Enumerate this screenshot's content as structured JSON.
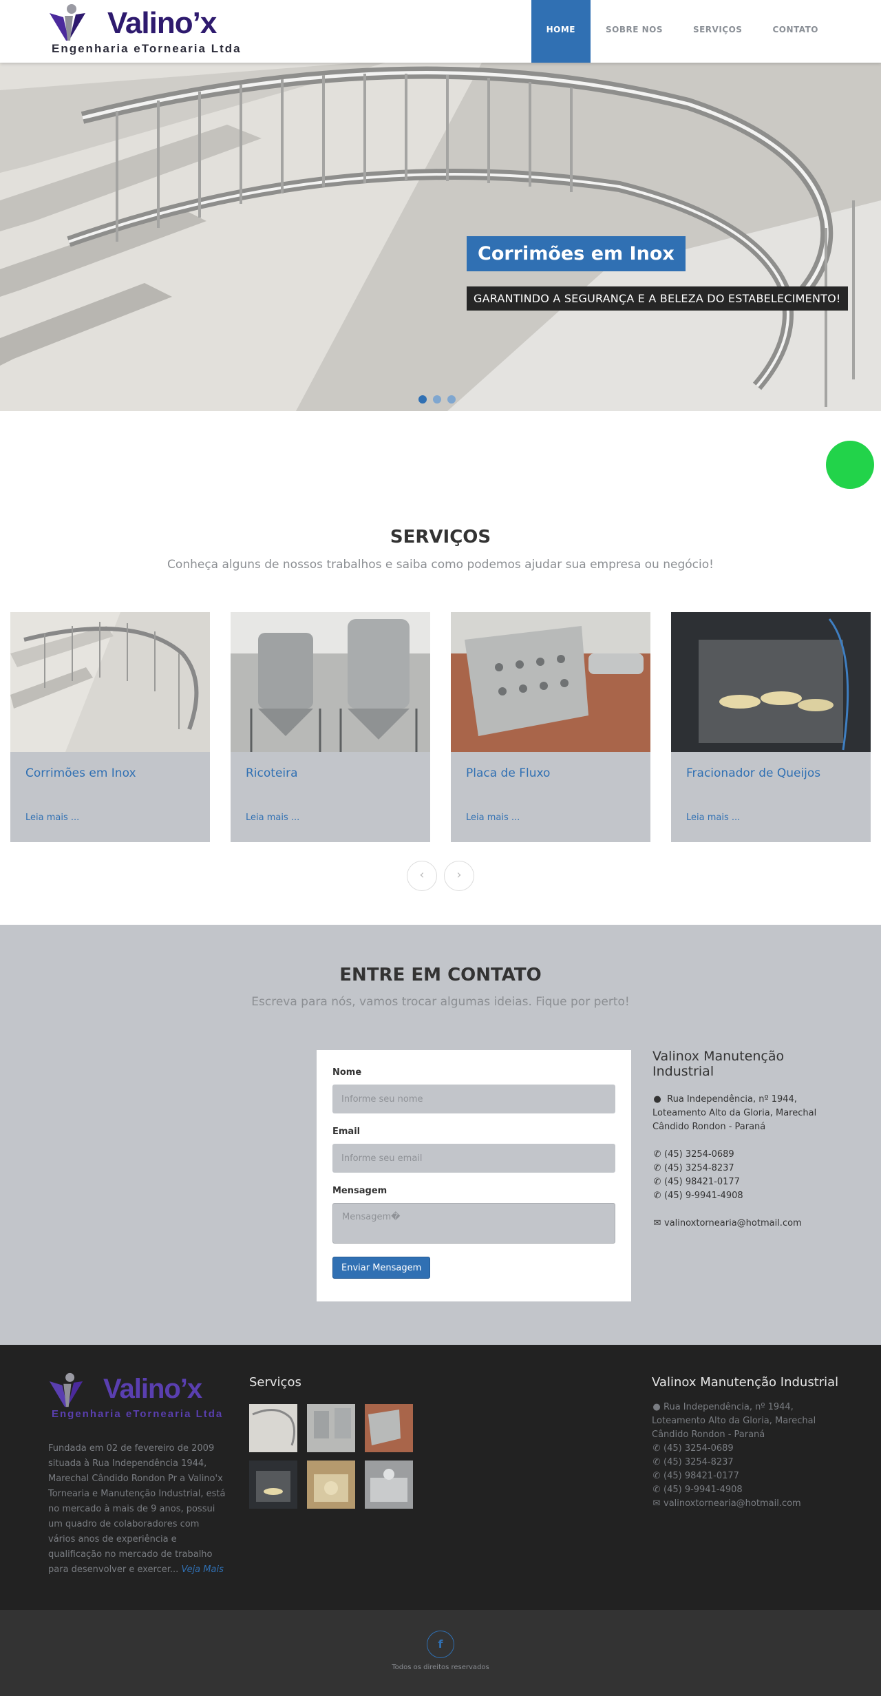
{
  "header": {
    "logo_title": "Valino’x",
    "logo_sub": "Engenharia eTornearia Ltda",
    "nav": [
      {
        "label": "HOME"
      },
      {
        "label": "SOBRE NOS"
      },
      {
        "label": "SERVIÇOS"
      },
      {
        "label": "CONTATO"
      }
    ]
  },
  "hero": {
    "title": "Corrimões em Inox",
    "subtitle": "GARANTINDO A SEGURANÇA E A BELEZA DO ESTABELECIMENTO!",
    "active_slide": 1,
    "slides": 3
  },
  "services": {
    "title": "SERVIÇOS",
    "subtitle": "Conheça alguns de nossos trabalhos e saiba como podemos ajudar sua empresa ou negócio!",
    "cards": [
      {
        "title": "Corrimões em Inox",
        "more": "Leia mais ..."
      },
      {
        "title": "Ricoteira",
        "more": "Leia mais ..."
      },
      {
        "title": "Placa de Fluxo",
        "more": "Leia mais ..."
      },
      {
        "title": "Fracionador de Queijos",
        "more": "Leia mais ..."
      }
    ],
    "prev": "‹",
    "next": "›"
  },
  "contact": {
    "title": "ENTRE EM CONTATO",
    "subtitle": "Escreva para nós, vamos trocar algumas ideias. Fique por perto!",
    "form": {
      "name_label": "Nome",
      "name_placeholder": "Informe seu nome",
      "email_label": "Email",
      "email_placeholder": "Informe seu email",
      "message_label": "Mensagem",
      "message_placeholder": "Mensagem�",
      "submit": "Enviar Mensagem"
    },
    "info": {
      "company": "Valinox Manutenção Industrial",
      "address": "Rua Independência, nº 1944, Loteamento Alto da Gloria, Marechal Cândido Rondon - Paraná",
      "phones": [
        "(45) 3254-0689",
        "(45) 3254-8237",
        "(45) 98421-0177",
        "(45) 9-9941-4908"
      ],
      "email": "valinoxtornearia@hotmail.com"
    }
  },
  "footer": {
    "about": "Fundada em 02 de fevereiro de 2009 situada à Rua Independência 1944, Marechal Cândido Rondon Pr a Valino'x Tornearia e Manutenção Industrial, está no mercado à mais de 9 anos, possui um quadro de colaboradores com vários anos de experiência e qualificação no mercado de trabalho para desenvolver e exercer...",
    "about_link": "Veja Mais",
    "services_title": "Serviços",
    "company": "Valinox Manutenção Industrial",
    "address": "Rua Independência, nº 1944, Loteamento Alto da Gloria, Marechal Cândido Rondon - Paraná",
    "phones": [
      "(45) 3254-0689",
      "(45) 3254-8237",
      "(45) 98421-0177",
      "(45) 9-9941-4908"
    ],
    "email": "valinoxtornearia@hotmail.com",
    "social": "f",
    "rights": "Todos os direitos reservados"
  },
  "colors": {
    "primary": "#3070b3",
    "whatsapp": "#22d34a",
    "gray_section": "#c2c5ca",
    "footer": "#222222"
  }
}
